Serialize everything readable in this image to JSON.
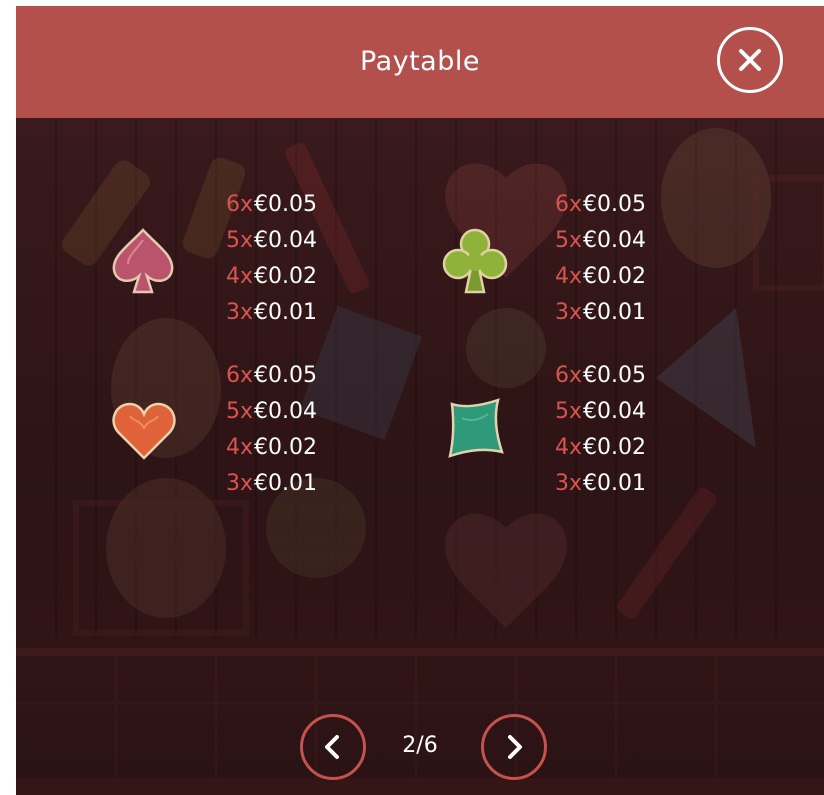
{
  "header": {
    "title": "Paytable",
    "close_icon": "close-icon"
  },
  "paytable": [
    {
      "symbol": "spade",
      "symbol_icon": "spade-icon",
      "color": "#c0607a",
      "payouts": [
        {
          "mult": "6x",
          "amount": "€0.05"
        },
        {
          "mult": "5x",
          "amount": "€0.04"
        },
        {
          "mult": "4x",
          "amount": "€0.02"
        },
        {
          "mult": "3x",
          "amount": "€0.01"
        }
      ]
    },
    {
      "symbol": "club",
      "symbol_icon": "club-icon",
      "color": "#8fb33a",
      "payouts": [
        {
          "mult": "6x",
          "amount": "€0.05"
        },
        {
          "mult": "5x",
          "amount": "€0.04"
        },
        {
          "mult": "4x",
          "amount": "€0.02"
        },
        {
          "mult": "3x",
          "amount": "€0.01"
        }
      ]
    },
    {
      "symbol": "heart",
      "symbol_icon": "heart-icon",
      "color": "#e0623a",
      "payouts": [
        {
          "mult": "6x",
          "amount": "€0.05"
        },
        {
          "mult": "5x",
          "amount": "€0.04"
        },
        {
          "mult": "4x",
          "amount": "€0.02"
        },
        {
          "mult": "3x",
          "amount": "€0.01"
        }
      ]
    },
    {
      "symbol": "diamond",
      "symbol_icon": "diamond-icon",
      "color": "#2f9a7a",
      "payouts": [
        {
          "mult": "6x",
          "amount": "€0.05"
        },
        {
          "mult": "5x",
          "amount": "€0.04"
        },
        {
          "mult": "4x",
          "amount": "€0.02"
        },
        {
          "mult": "3x",
          "amount": "€0.01"
        }
      ]
    }
  ],
  "pagination": {
    "current": "2/6",
    "prev_icon": "chevron-left-icon",
    "next_icon": "chevron-right-icon"
  },
  "colors": {
    "header": "#b4504c",
    "multiplier": "#d9544e",
    "background": "#2e1416"
  }
}
